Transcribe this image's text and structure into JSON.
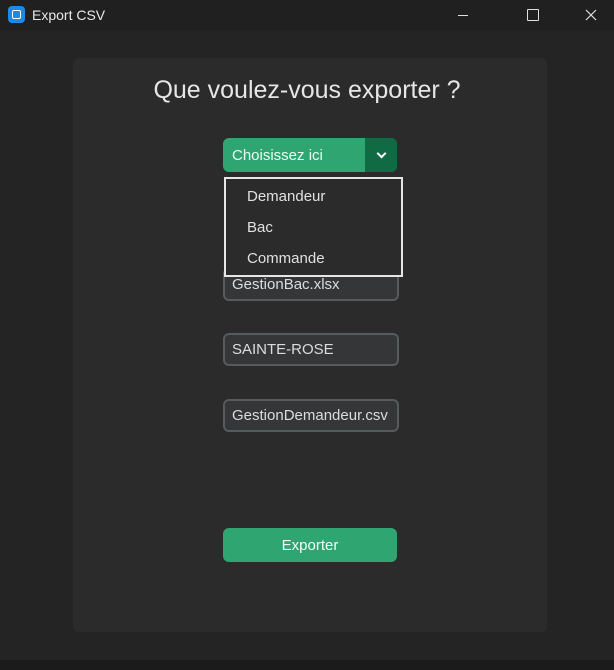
{
  "window": {
    "title": "Export CSV",
    "icon": "app-icon",
    "controls": [
      "minimize-icon",
      "maximize-icon",
      "close-icon"
    ]
  },
  "form": {
    "heading": "Que voulez-vous exporter ?",
    "combo": {
      "selected": "Choisissez ici",
      "options": [
        "Demandeur",
        "Bac",
        "Commande"
      ]
    },
    "fields": {
      "file1": "GestionBac.xlsx",
      "location": "SAINTE-ROSE",
      "file2": "GestionDemandeur.csv"
    },
    "export_label": "Exporter"
  },
  "colors": {
    "accent": "#2fa572",
    "accent_dark": "#106a43",
    "panel": "#2b2b2b",
    "window": "#242424"
  }
}
